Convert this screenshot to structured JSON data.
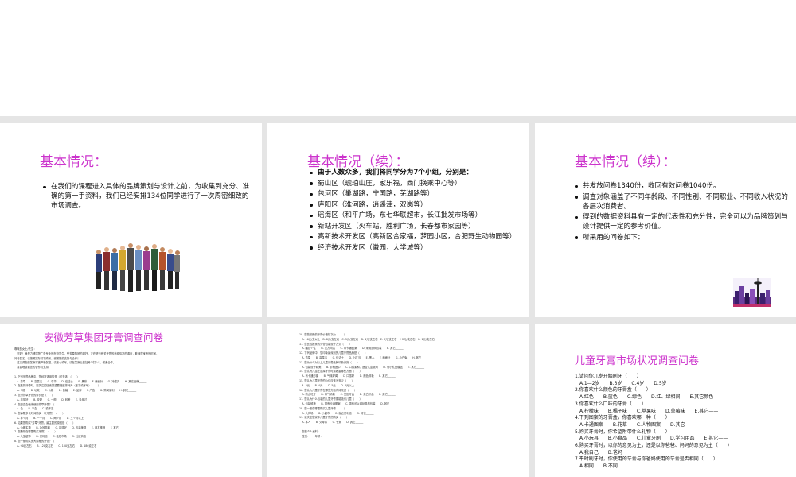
{
  "slide1": {
    "title": "基本情况：",
    "bullets": [
      "在我们的课程进入具体的品牌策划与设计之前，为收集到充分、准确的第一手资料，我们已经安排134位同学进行了一次周密细致的市场调查。"
    ]
  },
  "slide2": {
    "title": "基本情况（续）：",
    "bullets": [
      "由于人数众多，我们将同学分为7个小组，分别是：",
      "蜀山区（琥珀山庄，家乐福，西门换乘中心等）",
      "包河区（巢湖路，宁国路，芜湖路等）",
      "庐阳区（淮河路，逍遥津，双岗等）",
      "瑶海区（和平广场，东七华联超市，长江批发市场等）",
      "新站开发区（火车站，胜利广场，长春都市家园等）",
      "高新技术开发区（高新区合家福，梦园小区，合肥野生动物园等）",
      "经济技术开发区（徽园，大学城等）"
    ]
  },
  "slide3": {
    "title": "基本情况（续）：",
    "bullets": [
      "共发放问卷1340份，收回有效问卷1040份。",
      "调查对象涵盖了不同年龄段、不同性别、不同职业、不同收入状况的各层次消费者。",
      "得到的数据资料具有一定的代表性和充分性，完全可以为品牌策划与设计提供一定的参考价值。",
      "所采用的问卷如下："
    ]
  },
  "slide4": {
    "title": "安徽芳草集团牙膏调查问卷",
    "lines": [
      "尊敬的女士/先生：",
      "　您好！我是力博学院广告专业的在校学生，受芳草集团的委托，正在进行有关牙膏的消费情况的调查，耽误您宝贵的时间，",
      "问卷匿名，请按照实际情况填写，谢谢您的支持与合作！",
      "　这次调查的答案将被严格保密，请放心填写，请在答案后的括号中打\"√\"，谢谢合作。",
      "　真诚地感谢您的合作与支持！",
      "",
      "1. 下列牙膏品牌中，您经常选用的是（可多选）（　　）",
      "　A. 芳草　　B. 高露洁　　C. 中华　　D. 佳洁士　　E. 黑妹　　F. 两面针　　G. 冷酸灵　　H. 其它品牌______",
      "2. 在选择牙膏时，您关注的因素按重要程度排列为（依次填序号）（　　）",
      "　A. 口感　　B. 功效　　C. 价格　　D. 包装　　E. 品牌　　F. 广告　　G. 购买便利　　H. 其它______",
      "3. 您对芳草牙膏的评价是（　　）",
      "　A. 非常好　　B. 较好　　C. 一般　　D. 较差　　E. 没用过",
      "4. 您是否会继续使用芳草牙膏？（　　）",
      "　A. 会　　B. 不会　　C. 说不定",
      "5. 您每隔多长时间购买一次牙膏？（　　）",
      "　A. 半个月　　B. 一个月　　C. 两个月　　D. 三个月以上",
      "6. 如果您购买\"芳草\"牙膏，最主要的原因是（　　）",
      "　A. 价格实惠　　B. 功效显著　　C. 口感好　　D. 包装美观　　E. 朋友推荐　　F. 其它______",
      "7. 您通常在哪里购买牙膏？（　　）",
      "　A. 大型超市　　B. 便利店　　C. 批发市场　　D. 社区商店",
      "8. 您一般购买多大规格的牙膏？（　　）",
      "　A. 90克左右　　B. 120克左右　　C. 150克左右　　D. 180克左右"
    ]
  },
  "slide5": {
    "lines": [
      "10. 您能接受的牙膏价格档次为（　　）",
      "　A. 10元/支以上　B. 8元/支左右　C. 5元/支左右　D. 4元/支左右　E. 3元/支左右　F. 2元/支左右　G. 1元/支左右",
      "11. 您比较推崇的牙膏包装设计方式（　　）",
      "　A. 醒目个性　　B. 大方简洁　　C. 带卡通图案　　D. 采用透明包装　　E. 其它______",
      "12. 下列品牌中，您印象最深刻的儿童牙膏品牌是（　　）",
      "　A. 芳草　　B. 高露洁　　C. 佳洁士　　D. 小叮当　　E. 黑人　　F. 两面针　　G. 小白兔　　H. 其它______",
      "13. 您为什么对以上儿童牙膏品牌印象深刻（　　）",
      "　A. 包装设计精美　　B. 价格适中　　C. 口感柔和、适合儿童使用　　D. 有小礼品赠送　　E. 其它______",
      "14. 您认为儿童在选择牙膏时最看重哪些方面（　　）",
      "　A. 有卡通形象　　B. 气味好闻　　C. 口感好　　D. 颜色鲜艳　　E. 其它______",
      "15. 您认为儿童牙膏的价位应该为多少（　　）",
      "　A. 3元　　B. 4元　　C. 5元　　D. 6元以上",
      "16. 您认为儿童牙膏在哪些方面有待改进（　　）",
      "　A. 防止蛀牙　　B. 口气清新　　C. 坚固牙齿　　D. 美白牙齿　　E. 其它______",
      "17. 您认为什么包装的儿童牙膏更能吸引儿童（　　）",
      "　A. 包装鲜艳　　B. 带有卡通图案　　C. 带有可以做玩具的包装　　D. 其它______",
      "18. 您一般在哪里购买儿童牙膏（　　）",
      "　A. 大商场　　B. 小超市　　C. 就近便利店　　D. 其它______",
      "19. 谁决定您家中儿童牙膏的购买（　　）",
      "　A. 本人　　B. 父母亲　　C. 子女　　D. 其它______",
      "",
      "　您的个人资料：",
      "　性别：　　年龄："
    ]
  },
  "slide6": {
    "title": "儿童牙膏市场状况调查问卷",
    "lines": [
      "1.请问你几岁开始刷牙（　　）",
      "　A.1—2岁　　B.3岁　　C.4岁　　D.5岁",
      "2.你喜欢什么颜色的牙膏盒（　　）",
      "　A.红色　　B.蓝色　　C.绿色　　D.红、绿相间　　E.其它颜色——",
      "3.你喜欢什么口味的牙膏（　　）",
      "　A.柠檬味　　B.橘子味　　C.苹果味　　D.草莓味　　E.其它——",
      "4.下列图案的牙膏盒，你喜欢哪一种（　　）",
      "　A.卡通图案　　B.花草　　C.人物图案　　D.其它——",
      "5.购买牙膏时，你希望附带什么礼物（　　）",
      "　A.小玩具　　B.小食品　　C.儿童牙刷　　D.学习用品　　E.其它——",
      "6.购买牙膏时，以你的意见为主，还是以你爸爸、妈妈的意见为主（　　）",
      "　A.我自己　　B.爸妈",
      "7.平时刷牙时，你使用的牙膏与你爸妈使用的牙膏是否相同（　　）",
      "　A.相同　　B.不同"
    ]
  }
}
